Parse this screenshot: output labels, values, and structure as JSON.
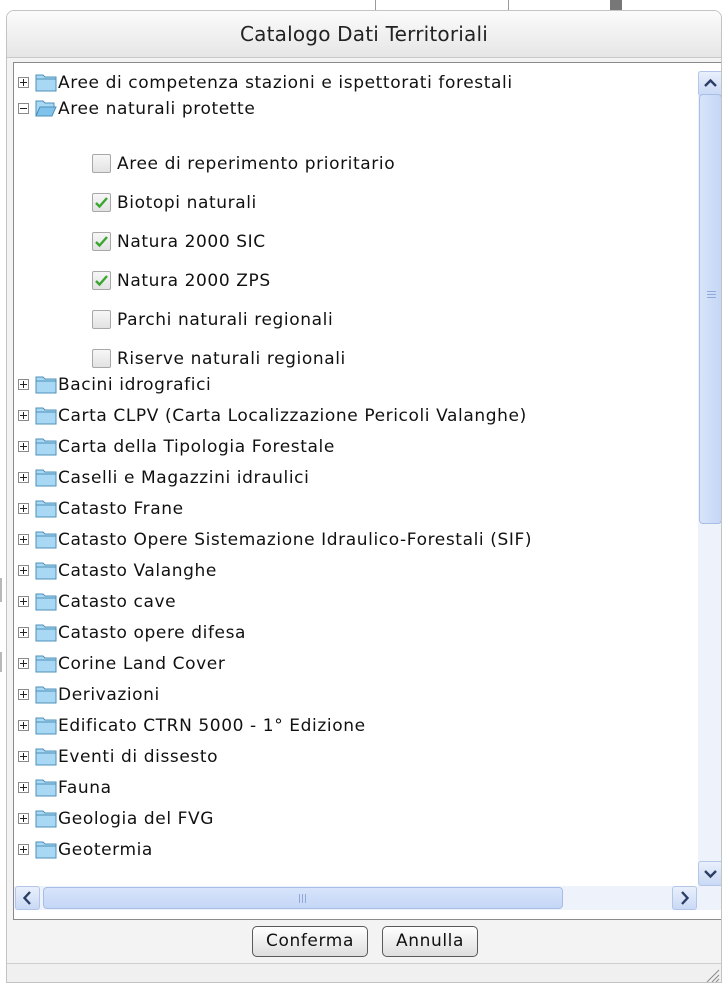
{
  "window": {
    "title": "Catalogo Dati Territoriali"
  },
  "tree": {
    "items": [
      {
        "label": "Aree di competenza stazioni e ispettorati forestali",
        "expanded": false,
        "icon": "folder-closed-icon"
      },
      {
        "label": "Aree naturali protette",
        "expanded": true,
        "icon": "folder-open-icon",
        "children": [
          {
            "label": "Aree di reperimento prioritario",
            "checked": false
          },
          {
            "label": "Biotopi naturali",
            "checked": true
          },
          {
            "label": "Natura 2000 SIC",
            "checked": true
          },
          {
            "label": "Natura 2000 ZPS",
            "checked": true
          },
          {
            "label": "Parchi naturali regionali",
            "checked": false
          },
          {
            "label": "Riserve naturali regionali",
            "checked": false
          }
        ]
      },
      {
        "label": "Bacini idrografici",
        "expanded": false,
        "icon": "folder-closed-icon"
      },
      {
        "label": "Carta CLPV (Carta Localizzazione Pericoli Valanghe)",
        "expanded": false,
        "icon": "folder-closed-icon"
      },
      {
        "label": "Carta della Tipologia Forestale",
        "expanded": false,
        "icon": "folder-closed-icon"
      },
      {
        "label": "Caselli e Magazzini idraulici",
        "expanded": false,
        "icon": "folder-closed-icon"
      },
      {
        "label": "Catasto Frane",
        "expanded": false,
        "icon": "folder-closed-icon"
      },
      {
        "label": "Catasto Opere Sistemazione Idraulico-Forestali (SIF)",
        "expanded": false,
        "icon": "folder-closed-icon"
      },
      {
        "label": "Catasto Valanghe",
        "expanded": false,
        "icon": "folder-closed-icon"
      },
      {
        "label": "Catasto cave",
        "expanded": false,
        "icon": "folder-closed-icon"
      },
      {
        "label": "Catasto opere difesa",
        "expanded": false,
        "icon": "folder-closed-icon"
      },
      {
        "label": "Corine Land Cover",
        "expanded": false,
        "icon": "folder-closed-icon"
      },
      {
        "label": "Derivazioni",
        "expanded": false,
        "icon": "folder-closed-icon"
      },
      {
        "label": "Edificato CTRN 5000 - 1° Edizione",
        "expanded": false,
        "icon": "folder-closed-icon"
      },
      {
        "label": "Eventi di dissesto",
        "expanded": false,
        "icon": "folder-closed-icon"
      },
      {
        "label": "Fauna",
        "expanded": false,
        "icon": "folder-closed-icon"
      },
      {
        "label": "Geologia del FVG",
        "expanded": false,
        "icon": "folder-closed-icon"
      },
      {
        "label": "Geotermia",
        "expanded": false,
        "icon": "folder-closed-icon"
      }
    ]
  },
  "buttons": {
    "confirm": "Conferma",
    "cancel": "Annulla"
  },
  "colors": {
    "check": "#3aa52f",
    "folder": "#7fc3ec",
    "scrollbar": "#c9d9f5"
  }
}
